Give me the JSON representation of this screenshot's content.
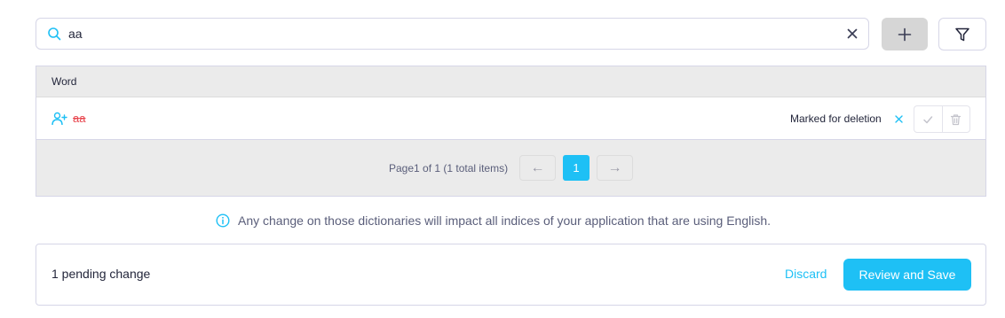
{
  "search": {
    "value": "aa",
    "icon": "search-icon",
    "clear_icon": "close-icon"
  },
  "toolbar": {
    "add_icon": "plus-icon",
    "filter_icon": "filter-icon"
  },
  "table": {
    "column_header": "Word",
    "rows": [
      {
        "icon": "user-plus-icon",
        "word": "aa",
        "status": "Marked for deletion",
        "undo_icon": "close-icon",
        "confirm_icon": "check-icon",
        "delete_icon": "trash-icon"
      }
    ]
  },
  "pagination": {
    "info": "Page1 of 1 (1 total items)",
    "prev": "←",
    "current": "1",
    "next": "→"
  },
  "notice": {
    "icon": "info-icon",
    "text": "Any change on those dictionaries will impact all indices of your application that are using English."
  },
  "footer": {
    "pending": "1 pending change",
    "discard": "Discard",
    "save": "Review and Save"
  },
  "colors": {
    "accent": "#1ec0f5",
    "deleted_word": "#e8474f",
    "border": "#d6d6e7",
    "table_bg": "#ebebeb"
  }
}
